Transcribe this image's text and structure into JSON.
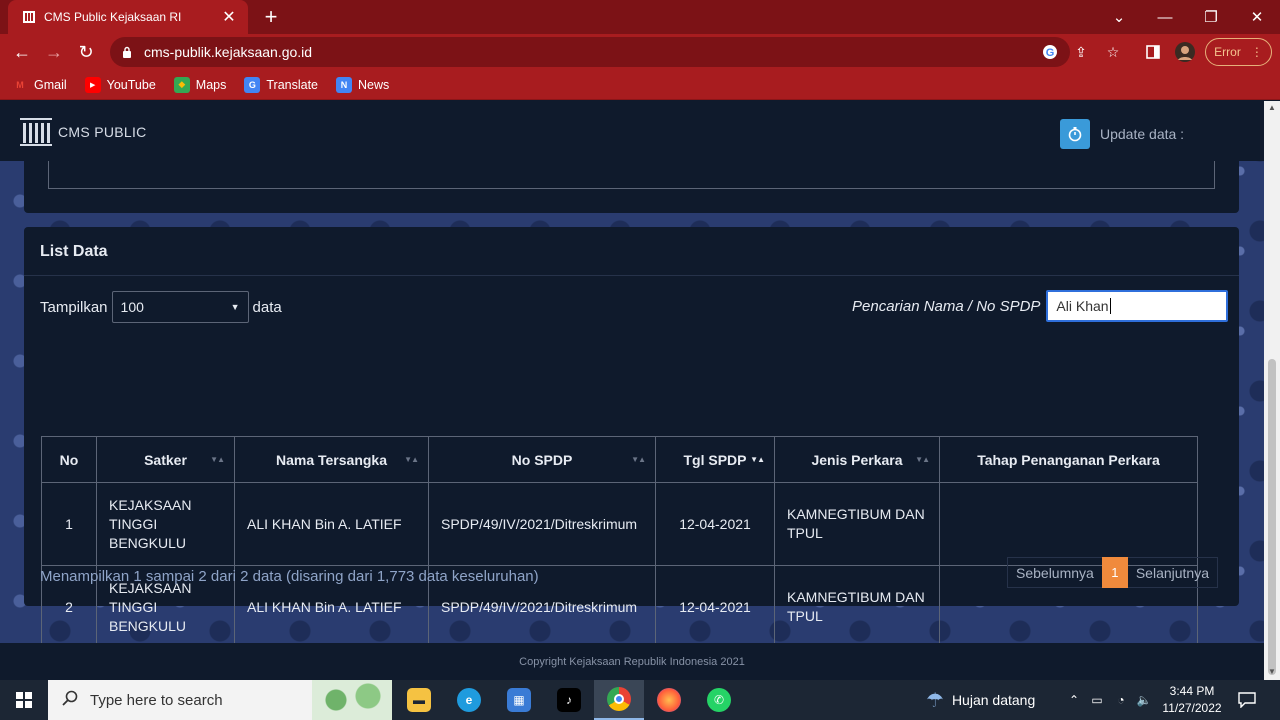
{
  "browser": {
    "tab_title": "CMS Public Kejaksaan RI",
    "url": "cms-publik.kejaksaan.go.id",
    "error_label": "Error",
    "bookmarks": [
      {
        "label": "Gmail",
        "icon": "gmail-icon",
        "color": "#ea4335"
      },
      {
        "label": "YouTube",
        "icon": "youtube-icon",
        "color": "#ff0000"
      },
      {
        "label": "Maps",
        "icon": "maps-icon",
        "color": "#34a853"
      },
      {
        "label": "Translate",
        "icon": "translate-icon",
        "color": "#4285f4"
      },
      {
        "label": "News",
        "icon": "news-icon",
        "color": "#4285f4"
      }
    ]
  },
  "header": {
    "logo_text": "CMS PUBLIC",
    "update_label": "Update data :"
  },
  "list": {
    "title": "List Data",
    "show_label": "Tampilkan",
    "page_size": "100",
    "data_label": "data",
    "search_label": "Pencarian Nama / No SPDP",
    "search_value": "Ali Khan",
    "columns": [
      "No",
      "Satker",
      "Nama Tersangka",
      "No SPDP",
      "Tgl SPDP",
      "Jenis Perkara",
      "Tahap Penanganan Perkara"
    ],
    "rows": [
      {
        "no": "1",
        "satker": "KEJAKSAAN TINGGI BENGKULU",
        "nama": "ALI KHAN Bin A. LATIEF",
        "spdp": "SPDP/49/IV/2021/Ditreskrimum",
        "tgl": "12-04-2021",
        "jenis": "KAMNEGTIBUM DAN TPUL",
        "tahap": ""
      },
      {
        "no": "2",
        "satker": "KEJAKSAAN TINGGI BENGKULU",
        "nama": "ALI KHAN Bin A. LATIEF",
        "spdp": "SPDP/49/IV/2021/Ditreskrimum",
        "tgl": "12-04-2021",
        "jenis": "KAMNEGTIBUM DAN TPUL",
        "tahap": ""
      }
    ],
    "info": "Menampilkan 1 sampai 2 dari 2 data (disaring dari 1,773 data keseluruhan)",
    "prev_label": "Sebelumnya",
    "current_page": "1",
    "next_label": "Selanjutnya"
  },
  "footer": {
    "copyright": "Copyright Kejaksaan Republik Indonesia 2021"
  },
  "taskbar": {
    "search_placeholder": "Type here to search",
    "weather": "Hujan datang",
    "time": "3:44 PM",
    "date": "11/27/2022"
  },
  "colors": {
    "chrome_red": "#a81c1f",
    "page_dark": "#0f1a2c",
    "accent_orange": "#f08a3c",
    "update_blue": "#3a9ad9"
  }
}
